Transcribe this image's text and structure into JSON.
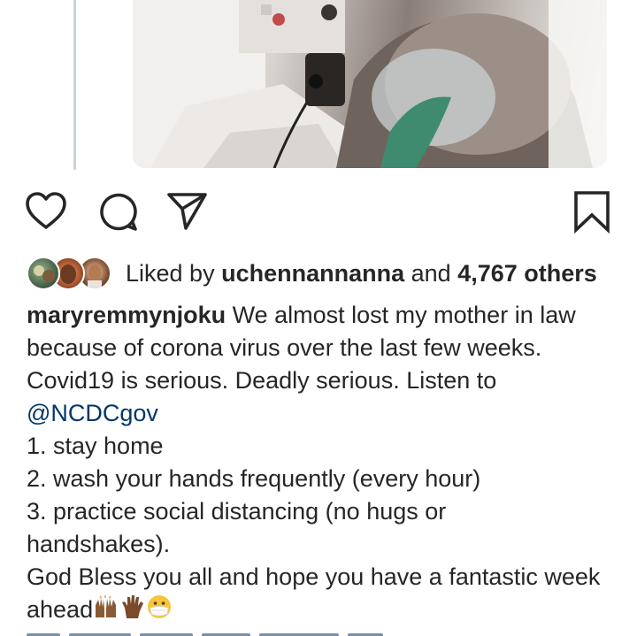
{
  "post": {
    "media": {
      "description_icon": "photo-icon"
    },
    "actions": {
      "like_icon": "heart-icon",
      "comment_icon": "comment-icon",
      "share_icon": "send-icon",
      "save_icon": "bookmark-icon"
    },
    "likes": {
      "prefix": "Liked by",
      "user": "uchennannanna",
      "middle": "and",
      "count": "4,767 others"
    },
    "caption": {
      "author": "maryremmynjoku",
      "line1_text": " We almost lost my mother in law",
      "line2": "because of corona virus over the last few weeks.",
      "line3": "Covid19 is serious. Deadly serious. Listen to",
      "mention": "@NCDCgov",
      "item1": "1. stay home",
      "item2": "2. wash your hands frequently (every hour)",
      "item3a": "3. practice social distancing (no hugs or",
      "item3b": "handshakes).",
      "closing1": "God Bless you all and hope you have a fantastic week",
      "closing2": "ahead"
    }
  },
  "colors": {
    "text": "#262626",
    "link": "#00376b",
    "icon": "#262626"
  }
}
